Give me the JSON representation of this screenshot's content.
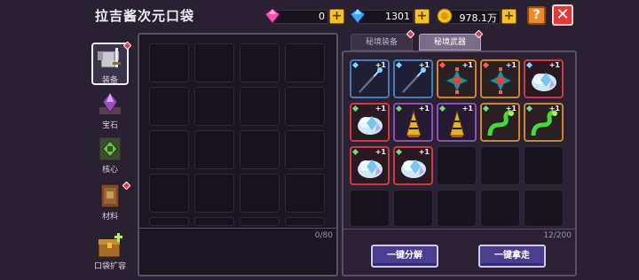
{
  "title": "拉吉酱次元口袋",
  "currency": {
    "pink_gems": "0",
    "blue_gems": "1301",
    "gold": "978.1万",
    "plus": "+"
  },
  "header": {
    "help": "?",
    "close": "✕"
  },
  "sidebar": {
    "items": [
      {
        "label": "装备",
        "active": true,
        "badge": true
      },
      {
        "label": "宝石",
        "active": false,
        "badge": false
      },
      {
        "label": "核心",
        "active": false,
        "badge": false
      },
      {
        "label": "材料",
        "active": false,
        "badge": true
      },
      {
        "label": "口袋扩容",
        "active": false,
        "badge": false
      }
    ]
  },
  "left_panel": {
    "count": "0/80"
  },
  "tabs": [
    {
      "label": "秘境装备",
      "active": false
    },
    {
      "label": "秘境武器",
      "active": true
    }
  ],
  "right_panel": {
    "count": "12/200",
    "items": [
      {
        "icon": "staff-icon",
        "level": "+1",
        "rarity": "blue",
        "gem": "#7ad8ff"
      },
      {
        "icon": "staff-icon",
        "level": "+1",
        "rarity": "blue",
        "gem": "#7ad8ff"
      },
      {
        "icon": "shuriken-icon",
        "level": "+1",
        "rarity": "orange",
        "gem": "#ff5a5a"
      },
      {
        "icon": "shuriken-icon",
        "level": "+1",
        "rarity": "orange",
        "gem": "#ff5a5a"
      },
      {
        "icon": "crystal-cloud-icon",
        "level": "+1",
        "rarity": "red",
        "gem": "#7ad8ff"
      },
      {
        "icon": "crystal-cloud-icon",
        "level": "+1",
        "rarity": "red",
        "gem": "#6adf7a"
      },
      {
        "icon": "drill-icon",
        "level": "+1",
        "rarity": "purple",
        "gem": "#6adf7a"
      },
      {
        "icon": "drill-icon",
        "level": "+1",
        "rarity": "purple",
        "gem": "#6adf7a"
      },
      {
        "icon": "serpent-icon",
        "level": "+1",
        "rarity": "orange",
        "gem": "#6adf7a"
      },
      {
        "icon": "serpent-icon",
        "level": "+1",
        "rarity": "orange",
        "gem": "#6adf7a"
      },
      {
        "icon": "crystal-cloud-icon",
        "level": "+1",
        "rarity": "red",
        "gem": "#6adf7a"
      },
      {
        "icon": "crystal-cloud-icon",
        "level": "+1",
        "rarity": "red",
        "gem": "#6adf7a"
      }
    ]
  },
  "buttons": {
    "decompose_all": "一键分解",
    "take_all": "一键拿走"
  }
}
